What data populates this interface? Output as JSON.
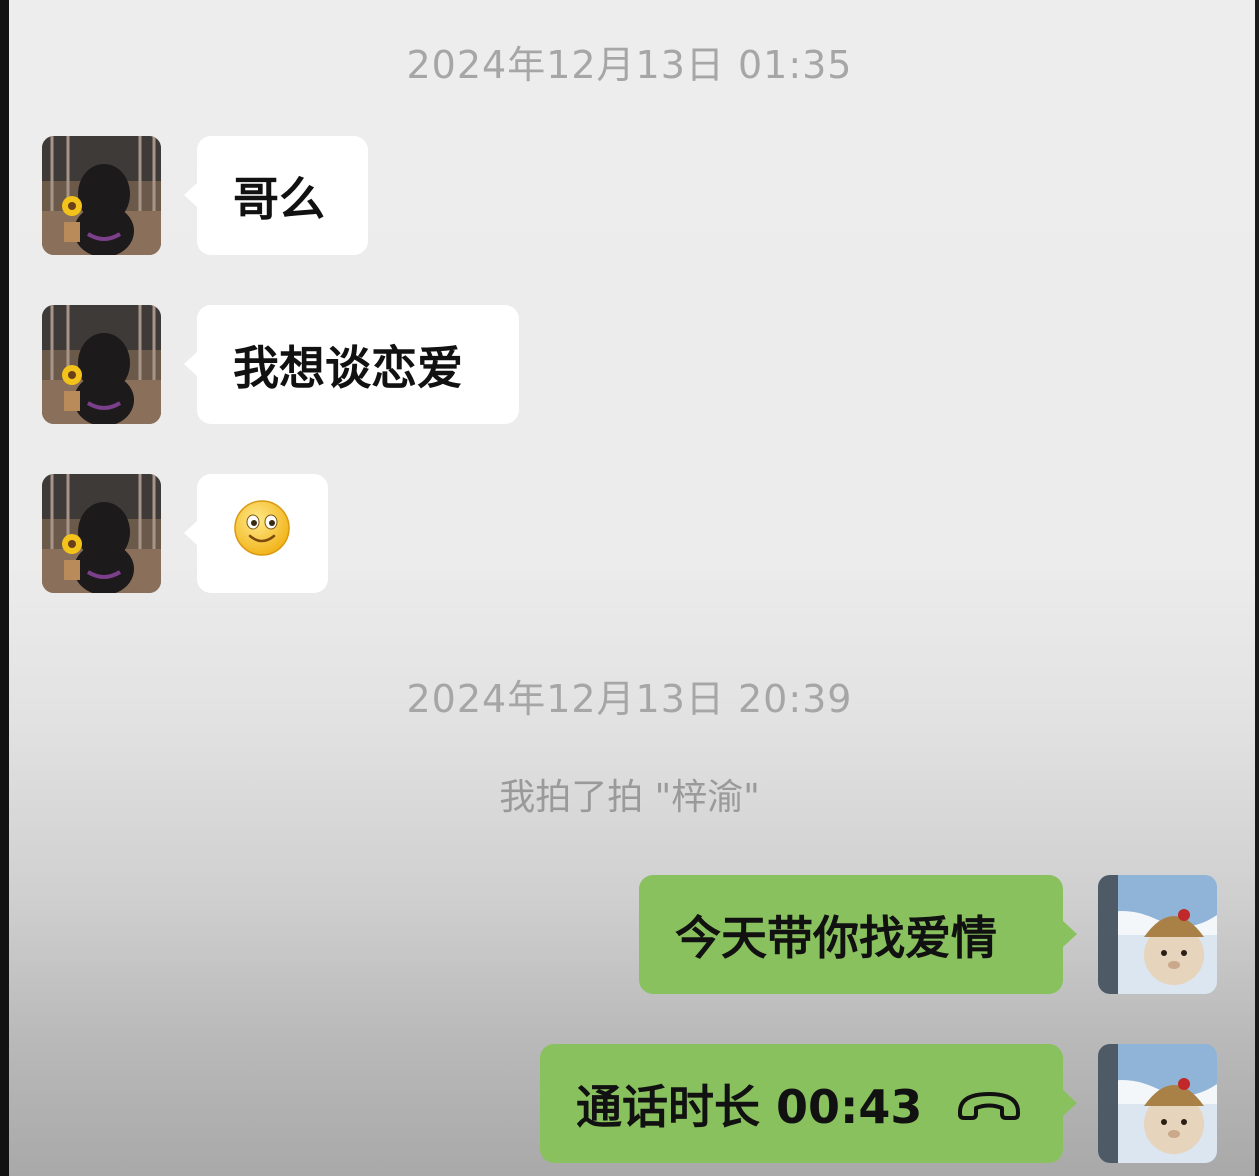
{
  "conversation": {
    "timestamp_1": "2024年12月13日 01:35",
    "timestamp_2": "2024年12月13日 20:39",
    "system_pat": "我拍了拍 \"梓渝\"",
    "incoming": [
      {
        "text": "哥么"
      },
      {
        "text": "我想谈恋爱"
      },
      {
        "emoji": "slightly-smiling-face-icon"
      }
    ],
    "outgoing": [
      {
        "text": "今天带你找爱情"
      },
      {
        "call_label": "通话时长 00:43",
        "icon": "phone-hangup-icon"
      }
    ]
  },
  "colors": {
    "background": "#ededed",
    "incoming_bubble": "#ffffff",
    "outgoing_bubble": "#8ac15f",
    "timestamp_text": "#a6a6a6"
  }
}
